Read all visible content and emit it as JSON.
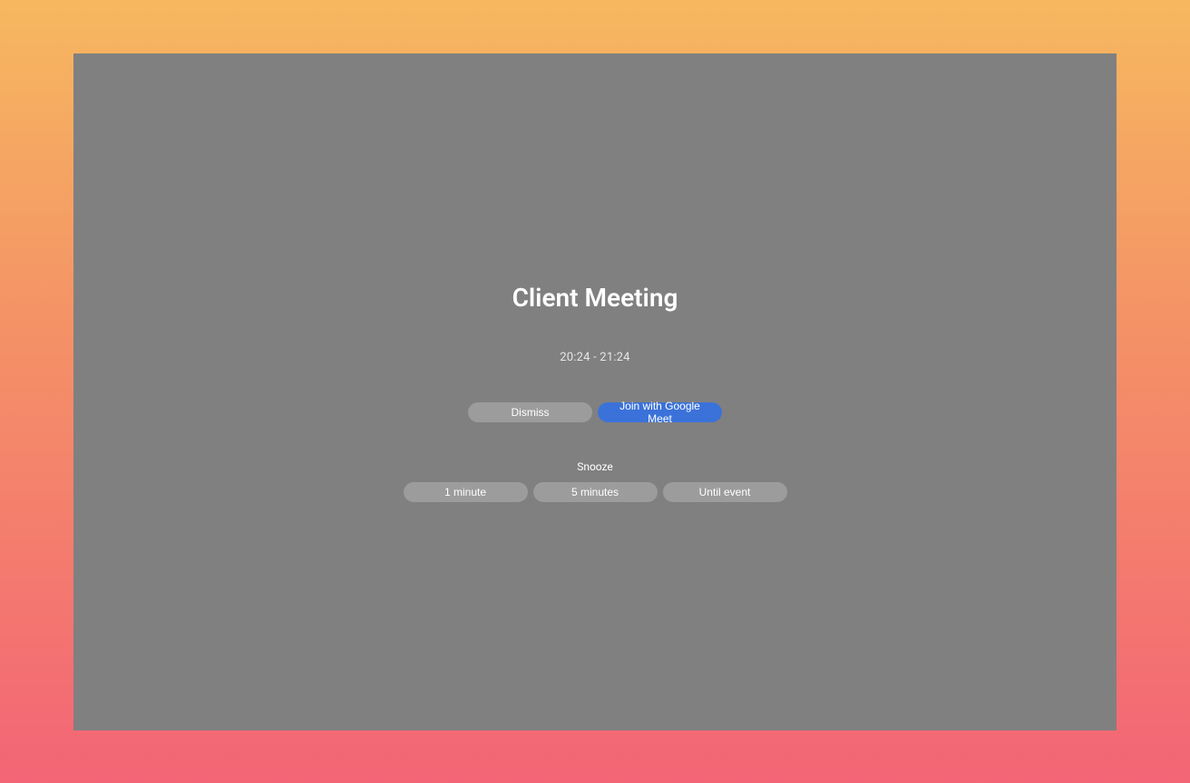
{
  "reminder": {
    "title": "Client Meeting",
    "time_range": "20:24 - 21:24",
    "actions": {
      "dismiss": "Dismiss",
      "join": "Join with Google Meet"
    },
    "snooze": {
      "label": "Snooze",
      "options": [
        "1 minute",
        "5 minutes",
        "Until event"
      ]
    }
  }
}
